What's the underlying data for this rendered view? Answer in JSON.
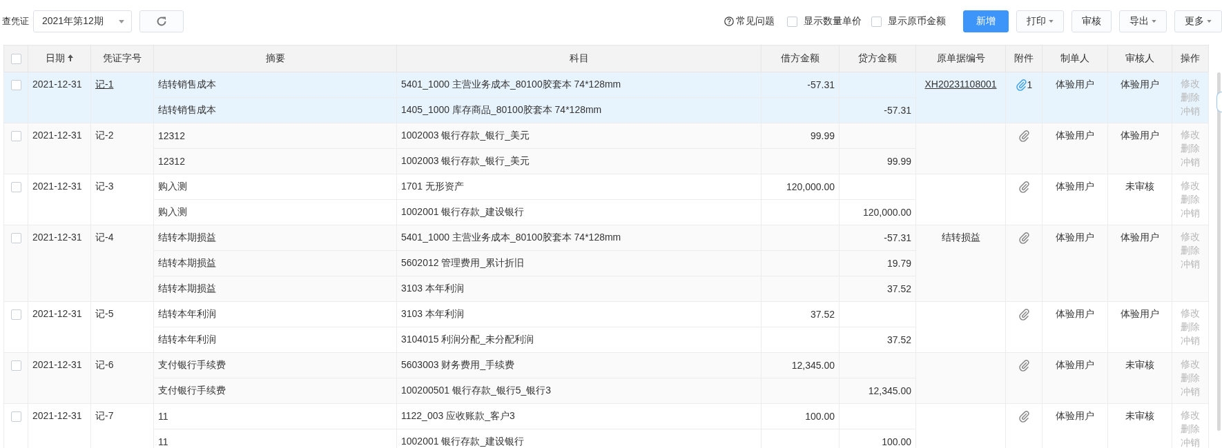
{
  "toolbar": {
    "label": "查凭证",
    "period": "2021年第12期",
    "help": "常见问题",
    "options": [
      {
        "label": "显示数量单价",
        "checked": false
      },
      {
        "label": "显示原币金额",
        "checked": false
      }
    ],
    "buttons": [
      {
        "label": "新增",
        "kind": "primary"
      },
      {
        "label": "打印",
        "kind": "dropdown"
      },
      {
        "label": "审核",
        "kind": "plain"
      },
      {
        "label": "导出",
        "kind": "dropdown"
      },
      {
        "label": "更多",
        "kind": "dropdown"
      }
    ]
  },
  "table": {
    "select_all": {
      "checked": false
    },
    "columns": [
      "日期",
      "凭证字号",
      "摘要",
      "科目",
      "借方金额",
      "贷方金额",
      "原单据编号",
      "附件",
      "制单人",
      "审核人",
      "操作"
    ],
    "vouchers": [
      {
        "selected": true,
        "checked": false,
        "date": "2021-12-31",
        "number": "记-1",
        "entries": [
          {
            "summary": "结转销售成本",
            "account": "5401_1000 主营业务成本_80100胶套本 74*128mm",
            "debit": "-57.31"
          },
          {
            "summary": "结转销售成本",
            "account": "1405_1000 库存商品_80100胶套本 74*128mm",
            "credit": "-57.31"
          }
        ],
        "source_no": "XH20231108001",
        "attachments": "1",
        "maker": "体验用户",
        "reviewer": "体验用户",
        "actions": [
          {
            "label": "修改",
            "disabled": true
          },
          {
            "label": "删除",
            "disabled": true
          },
          {
            "label": "冲销",
            "disabled": true
          }
        ]
      },
      {
        "selected": false,
        "checked": false,
        "date": "2021-12-31",
        "number": "记-2",
        "entries": [
          {
            "summary": "12312",
            "account": "1002003 银行存款_银行_美元",
            "debit": "99.99"
          },
          {
            "summary": "12312",
            "account": "1002003 银行存款_银行_美元",
            "credit": "99.99"
          }
        ],
        "maker": "体验用户",
        "reviewer": "体验用户",
        "actions": [
          {
            "label": "修改",
            "disabled": true
          },
          {
            "label": "删除",
            "disabled": true
          },
          {
            "label": "冲销",
            "disabled": true
          }
        ]
      },
      {
        "selected": false,
        "checked": false,
        "date": "2021-12-31",
        "number": "记-3",
        "entries": [
          {
            "summary": "购入测",
            "account": "1701 无形资产",
            "debit": "120,000.00"
          },
          {
            "summary": "购入测",
            "account": "1002001 银行存款_建设银行",
            "credit": "120,000.00"
          }
        ],
        "maker": "体验用户",
        "reviewer": "未审核",
        "actions": [
          {
            "label": "修改",
            "disabled": true
          },
          {
            "label": "删除",
            "disabled": true
          },
          {
            "label": "冲销",
            "disabled": true
          }
        ]
      },
      {
        "selected": false,
        "checked": false,
        "date": "2021-12-31",
        "number": "记-4",
        "entries": [
          {
            "summary": "结转本期损益",
            "account": "5401_1000 主营业务成本_80100胶套本 74*128mm",
            "credit": "-57.31"
          },
          {
            "summary": "结转本期损益",
            "account": "5602012 管理费用_累计折旧",
            "credit": "19.79"
          },
          {
            "summary": "结转本期损益",
            "account": "3103 本年利润",
            "credit": "37.52"
          }
        ],
        "source_no": "结转损益",
        "maker": "体验用户",
        "reviewer": "体验用户",
        "actions": [
          {
            "label": "修改",
            "disabled": true
          },
          {
            "label": "删除",
            "disabled": true
          },
          {
            "label": "冲销",
            "disabled": true
          }
        ]
      },
      {
        "selected": false,
        "checked": false,
        "date": "2021-12-31",
        "number": "记-5",
        "entries": [
          {
            "summary": "结转本年利润",
            "account": "3103 本年利润",
            "debit": "37.52"
          },
          {
            "summary": "结转本年利润",
            "account": "3104015 利润分配_未分配利润",
            "credit": "37.52"
          }
        ],
        "maker": "体验用户",
        "reviewer": "体验用户",
        "actions": [
          {
            "label": "修改",
            "disabled": true
          },
          {
            "label": "删除",
            "disabled": true
          },
          {
            "label": "冲销",
            "disabled": true
          }
        ]
      },
      {
        "selected": false,
        "checked": false,
        "date": "2021-12-31",
        "number": "记-6",
        "entries": [
          {
            "summary": "支付银行手续费",
            "account": "5603003 财务费用_手续费",
            "debit": "12,345.00"
          },
          {
            "summary": "支付银行手续费",
            "account": "100200501 银行存款_银行5_银行3",
            "credit": "12,345.00"
          }
        ],
        "maker": "体验用户",
        "reviewer": "未审核",
        "actions": [
          {
            "label": "修改",
            "disabled": true
          },
          {
            "label": "删除",
            "disabled": true
          },
          {
            "label": "冲销",
            "disabled": true
          }
        ]
      },
      {
        "selected": false,
        "checked": false,
        "date": "2021-12-31",
        "number": "记-7",
        "entries": [
          {
            "summary": "11",
            "account": "1122_003 应收账款_客户3",
            "debit": "100.00"
          },
          {
            "summary": "11",
            "account": "1002001 银行存款_建设银行",
            "credit": "100.00"
          }
        ],
        "maker": "体验用户",
        "reviewer": "未审核",
        "actions": [
          {
            "label": "修改",
            "disabled": true
          },
          {
            "label": "删除",
            "disabled": true
          },
          {
            "label": "冲销",
            "disabled": true
          }
        ]
      }
    ]
  }
}
